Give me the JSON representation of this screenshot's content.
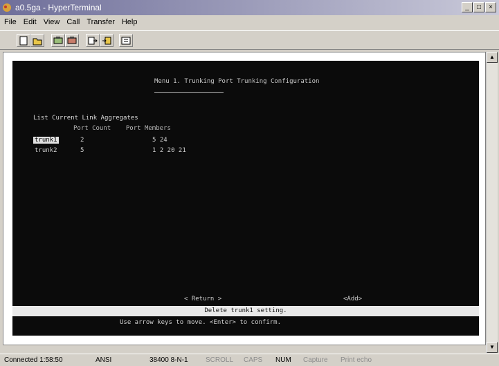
{
  "window": {
    "title": "a0.5ga - HyperTerminal"
  },
  "menu": {
    "items": [
      "File",
      "Edit",
      "View",
      "Call",
      "Transfer",
      "Help"
    ]
  },
  "toolbar": {
    "buttons": [
      "new-document-icon",
      "open-folder-icon",
      "connect-phone-icon",
      "disconnect-phone-icon",
      "send-file-icon",
      "receive-file-icon",
      "properties-icon"
    ]
  },
  "terminal": {
    "title": "Menu 1. Trunking Port Trunking Configuration",
    "heading": "List Current Link Aggregates",
    "columns": {
      "count": "Port Count",
      "members": "Port Members"
    },
    "rows": [
      {
        "name": "trunk1",
        "count": "2",
        "members": "5 24"
      },
      {
        "name": "trunk2",
        "count": "5",
        "members": "1 2 20 21"
      }
    ],
    "return_label": "< Return >",
    "add_label": "<Add>",
    "status": "Delete trunk1 setting.",
    "help": "Use arrow keys to move. <Enter> to confirm."
  },
  "statusbar": {
    "connected": "Connected 1:58:50",
    "emulation": "ANSI",
    "settings": "38400 8-N-1",
    "scroll": "SCROLL",
    "caps": "CAPS",
    "num": "NUM",
    "capture": "Capture",
    "print_echo": "Print echo"
  }
}
